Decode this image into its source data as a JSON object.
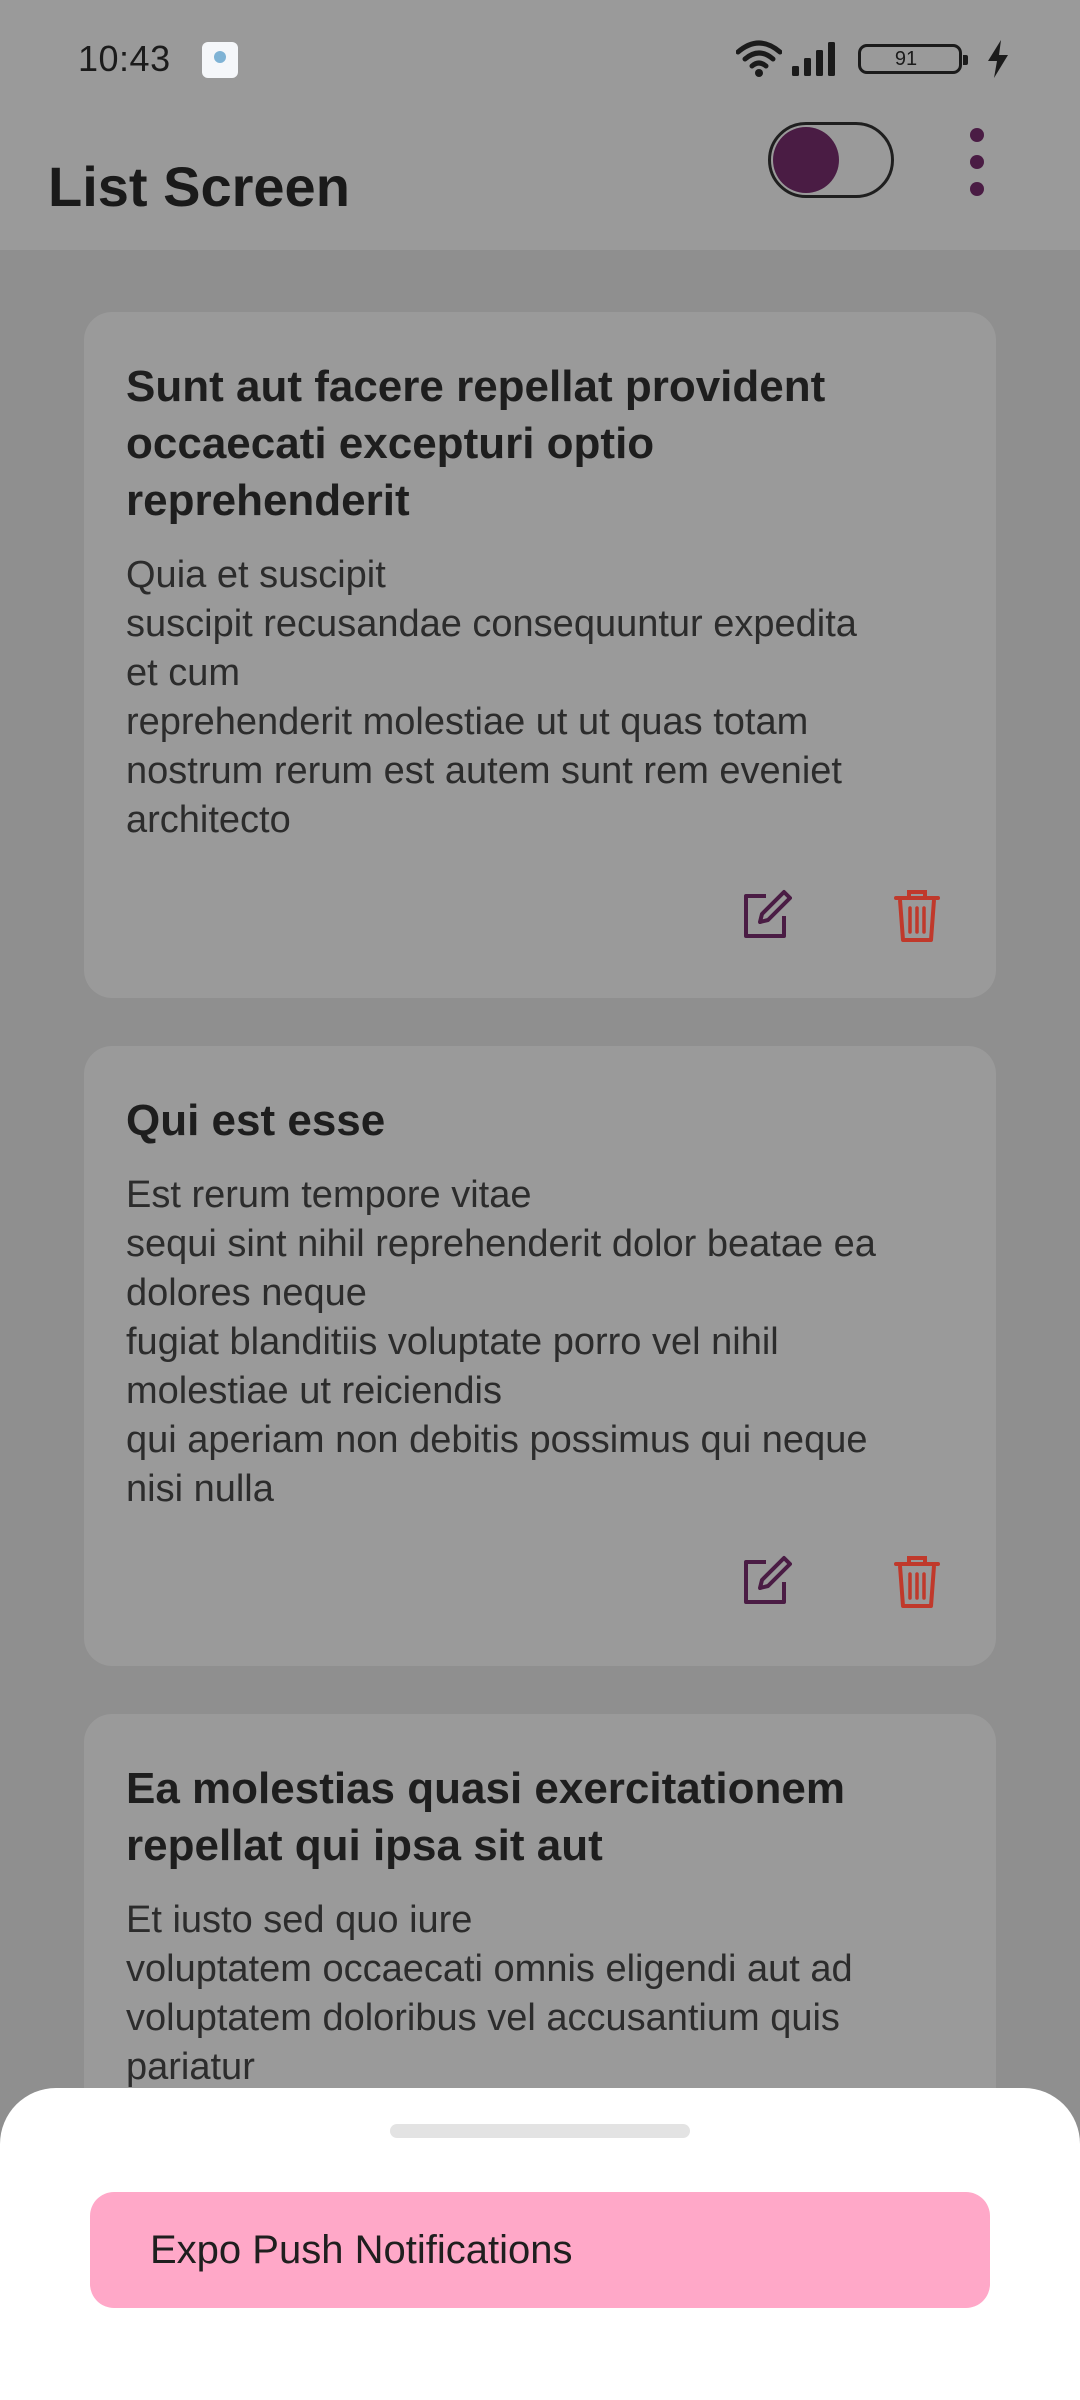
{
  "status_bar": {
    "time": "10:43",
    "battery_level": "91"
  },
  "app_bar": {
    "title": "List Screen",
    "toggle_on": true
  },
  "colors": {
    "accent": "#4a1c44",
    "delete": "#c0392b",
    "sheet_button": "#ffa8c8"
  },
  "posts": [
    {
      "title": "Sunt aut facere repellat provident\noccaecati excepturi optio\nreprehenderit",
      "body": "Quia et suscipit\nsuscipit recusandae consequuntur expedita\net cum\nreprehenderit molestiae ut ut quas totam\nnostrum rerum est autem sunt rem eveniet\narchitecto"
    },
    {
      "title": "Qui est esse",
      "body": "Est rerum tempore vitae\nsequi sint nihil reprehenderit dolor beatae ea\ndolores neque\nfugiat blanditiis voluptate porro vel nihil\nmolestiae ut reiciendis\nqui aperiam non debitis possimus qui neque\nnisi nulla"
    },
    {
      "title": "Ea molestias quasi exercitationem\nrepellat qui ipsa sit aut",
      "body": "Et iusto sed quo iure\nvoluptatem occaecati omnis eligendi aut ad\nvoluptatem doloribus vel accusantium quis\npariatur"
    }
  ],
  "bottom_sheet": {
    "button_label": "Expo Push Notifications"
  }
}
